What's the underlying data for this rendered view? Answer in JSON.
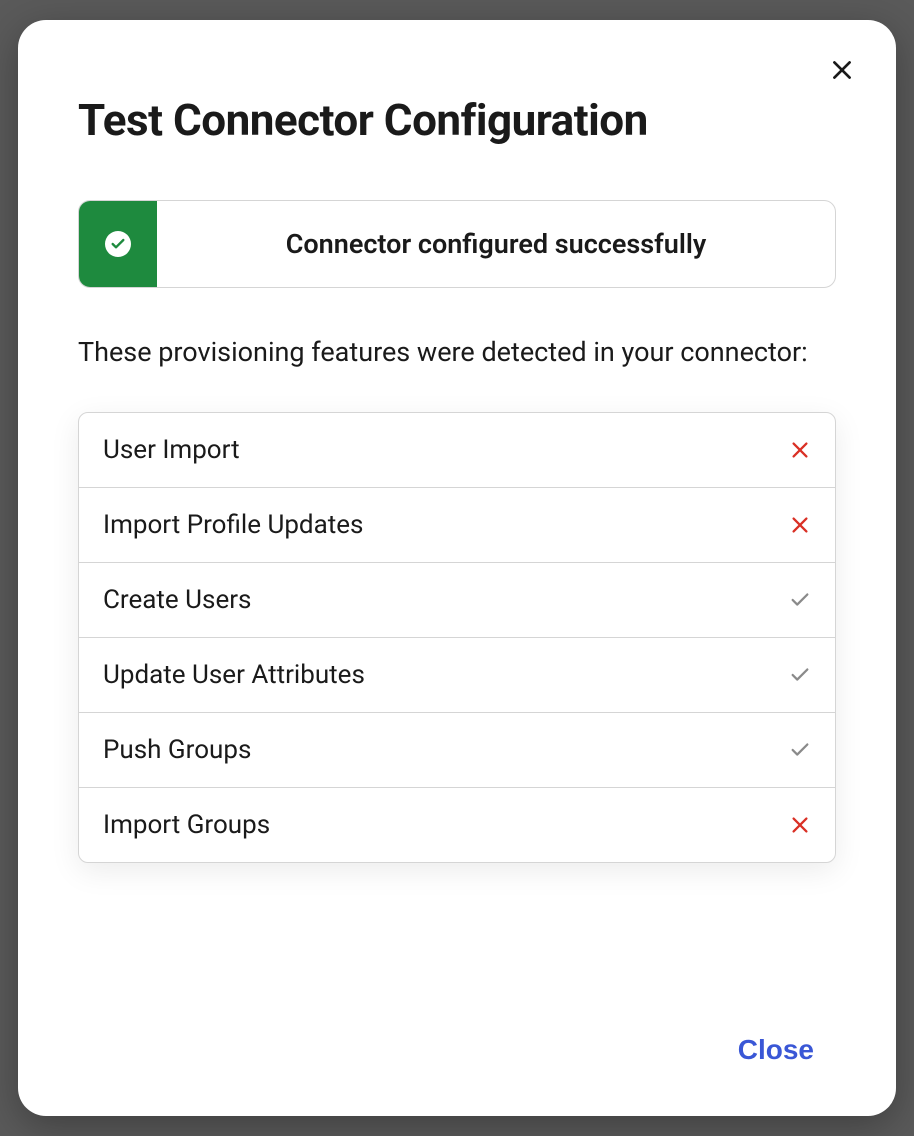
{
  "modal": {
    "title": "Test Connector Configuration",
    "success_message": "Connector configured successfully",
    "description": "These provisioning features were detected in your connector:",
    "close_button": "Close"
  },
  "features": [
    {
      "label": "User Import",
      "status": "fail"
    },
    {
      "label": "Import Profile Updates",
      "status": "fail"
    },
    {
      "label": "Create Users",
      "status": "pass"
    },
    {
      "label": "Update User Attributes",
      "status": "pass"
    },
    {
      "label": "Push Groups",
      "status": "pass"
    },
    {
      "label": "Import Groups",
      "status": "fail"
    }
  ]
}
